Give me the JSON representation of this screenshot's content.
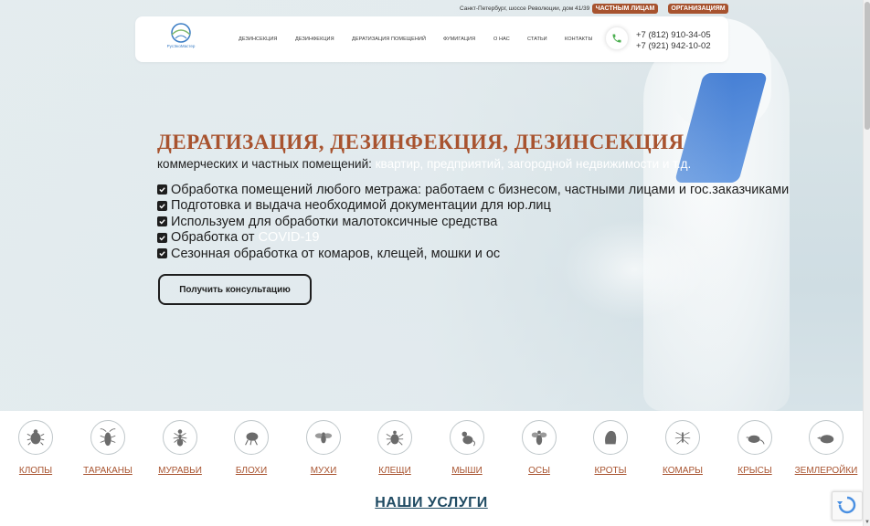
{
  "topbar": {
    "address": "Санкт-Петербург, шоссе Революции, дом 41/39",
    "private_label": "ЧАСТНЫМ ЛИЦАМ",
    "org_label": "ОРГАНИЗАЦИЯМ"
  },
  "header": {
    "logo_text": "РусЭкоМастер",
    "nav": [
      {
        "label": "ДЕЗИНСЕКЦИЯ"
      },
      {
        "label": "ДЕЗИНФЕКЦИЯ"
      },
      {
        "label": "ДЕРАТИЗАЦИЯ ПОМЕЩЕНИЙ"
      },
      {
        "label": "ФУМИГАЦИЯ"
      },
      {
        "label": "О НАС"
      },
      {
        "label": "СТАТЬИ"
      },
      {
        "label": "КОНТАКТЫ"
      }
    ],
    "phones": [
      "+7 (812) 910-34-05",
      "+7 (921) 942-10-02"
    ]
  },
  "hero": {
    "headline": "ДЕРАТИЗАЦИЯ, ДЕЗИНФЕКЦИЯ, ДЕЗИНСЕКЦИЯ",
    "subline_dark": "коммерческих и частных помещений:",
    "subline_light": "квартир, предприятий, загородной недвижимости и т.д.",
    "checks": [
      {
        "dark": "Обработка помещений любого метража: работаем с бизнесом, частными лицами и гос.заказчиками",
        "light": ""
      },
      {
        "dark": "Подготовка и выдача необходимой документации для юр.лиц",
        "light": ""
      },
      {
        "dark": "Используем для обработки малотоксичные средства",
        "light": ""
      },
      {
        "dark": "Обработка от",
        "light": "COVID-19"
      },
      {
        "dark": "Сезонная обработка от комаров, клещей, мошки и ос",
        "light": ""
      }
    ],
    "cta_label": "Получить консультацию"
  },
  "pests": [
    {
      "label": "КЛОПЫ",
      "icon": "bedbug-icon"
    },
    {
      "label": "ТАРАКАНЫ",
      "icon": "cockroach-icon"
    },
    {
      "label": "МУРАВЬИ",
      "icon": "ant-icon"
    },
    {
      "label": "БЛОХИ",
      "icon": "flea-icon"
    },
    {
      "label": "МУХИ",
      "icon": "fly-icon"
    },
    {
      "label": "КЛЕЩИ",
      "icon": "tick-icon"
    },
    {
      "label": "МЫШИ",
      "icon": "mouse-icon"
    },
    {
      "label": "ОСЫ",
      "icon": "wasp-icon"
    },
    {
      "label": "КРОТЫ",
      "icon": "mole-icon"
    },
    {
      "label": "КОМАРЫ",
      "icon": "mosquito-icon"
    },
    {
      "label": "КРЫСЫ",
      "icon": "rat-icon"
    },
    {
      "label": "ЗЕМЛЕРОЙКИ",
      "icon": "shrew-icon"
    }
  ],
  "services_title": "НАШИ УСЛУГИ",
  "colors": {
    "accent": "#a8532f",
    "services_title": "#1f4a62"
  }
}
